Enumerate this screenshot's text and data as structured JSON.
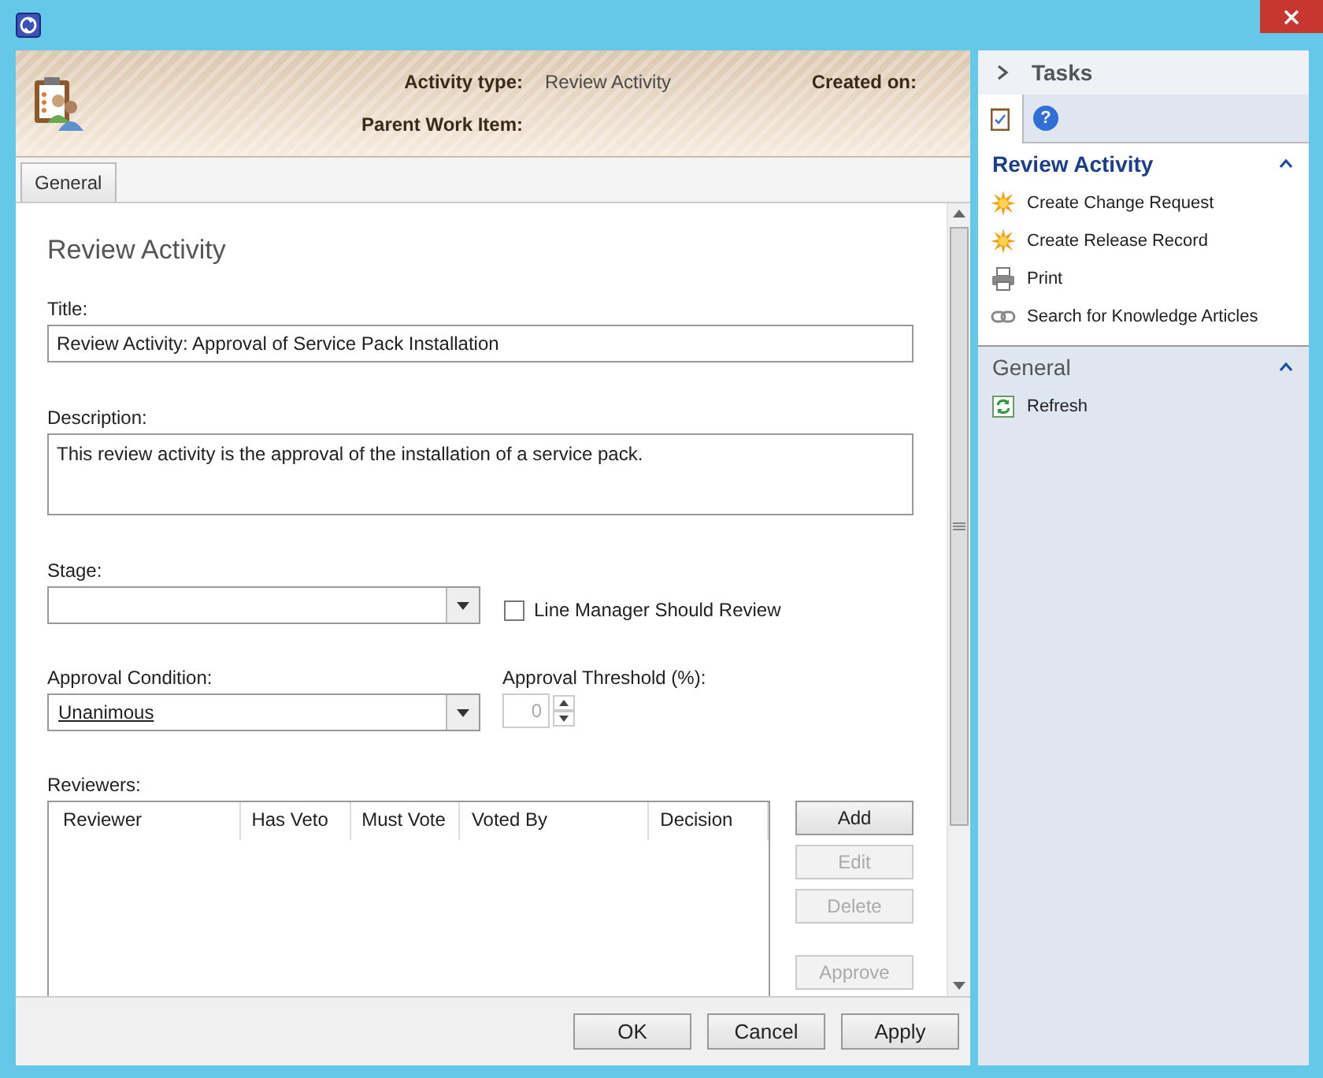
{
  "header": {
    "activity_type_label": "Activity type:",
    "activity_type_value": "Review Activity",
    "created_on_label": "Created on:",
    "parent_label": "Parent Work Item:"
  },
  "tabs": [
    {
      "label": "General",
      "selected": true
    }
  ],
  "form": {
    "heading": "Review Activity",
    "title": {
      "label": "Title:",
      "value": "Review Activity: Approval of Service Pack Installation"
    },
    "description": {
      "label": "Description:",
      "value": "This review activity is the approval of the installation of a service pack."
    },
    "stage": {
      "label": "Stage:"
    },
    "line_manager": {
      "label": "Line Manager Should Review",
      "checked": false
    },
    "approval_condition": {
      "label": "Approval Condition:",
      "value": "Unanimous"
    },
    "threshold": {
      "label": "Approval Threshold (%):",
      "value": "0",
      "disabled": true
    },
    "reviewers": {
      "label": "Reviewers:",
      "columns": [
        "Reviewer",
        "Has Veto",
        "Must Vote",
        "Voted By",
        "Decision"
      ]
    },
    "reviewer_buttons": [
      {
        "label": "Add",
        "disabled": false
      },
      {
        "label": "Edit",
        "disabled": true
      },
      {
        "label": "Delete",
        "disabled": true
      },
      {
        "label": "Approve",
        "disabled": true
      }
    ]
  },
  "footer_buttons": [
    "OK",
    "Cancel",
    "Apply"
  ],
  "tasks": {
    "title": "Tasks",
    "help_tab": "?",
    "sections": [
      {
        "title": "Review Activity",
        "kind": "primary",
        "expanded": true,
        "items": [
          {
            "label": "Create Change Request",
            "kind": "sparkle"
          },
          {
            "label": "Create Release Record",
            "kind": "sparkle"
          },
          {
            "label": "Print",
            "kind": "printer"
          },
          {
            "label": "Search for Knowledge Articles",
            "kind": "link"
          }
        ]
      },
      {
        "title": "General",
        "kind": "secondary",
        "expanded": true,
        "items": [
          {
            "label": "Refresh",
            "kind": "refresh"
          }
        ]
      }
    ]
  }
}
